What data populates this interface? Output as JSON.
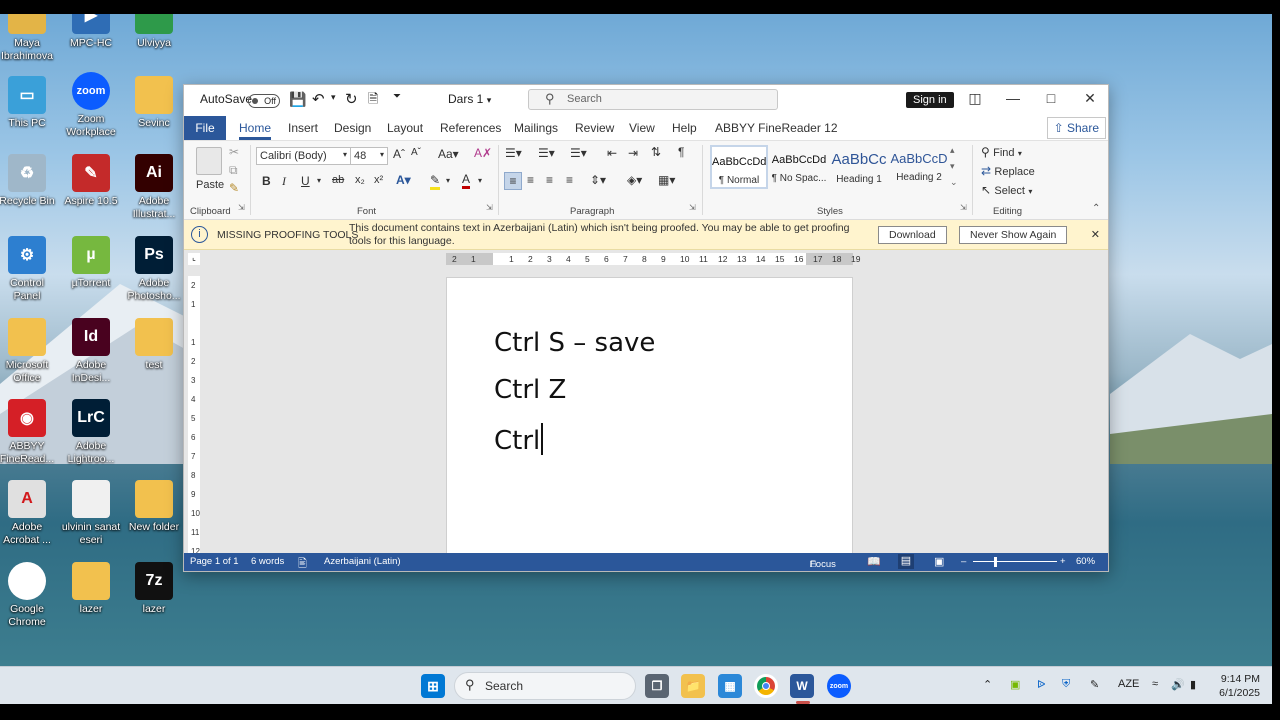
{
  "desktop": {
    "icons": [
      {
        "label": "Maya\nIbrahimova",
        "icon": "folder-user-icon"
      },
      {
        "label": "MPC-HC",
        "icon": "mpc-icon"
      },
      {
        "label": "Ulviyya",
        "icon": "chrome-profile-icon"
      },
      {
        "label": "This PC",
        "icon": "monitor-icon"
      },
      {
        "label": "Zoom\nWorkplace",
        "icon": "zoom-icon"
      },
      {
        "label": "Sevinc",
        "icon": "folder-icon"
      },
      {
        "label": "Recycle Bin",
        "icon": "recycle-bin-icon"
      },
      {
        "label": "Aspire 10.5",
        "icon": "aspire-icon"
      },
      {
        "label": "Adobe\nIllustrat...",
        "icon": "illustrator-icon"
      },
      {
        "label": "Control Panel",
        "icon": "control-panel-icon"
      },
      {
        "label": "µTorrent",
        "icon": "utorrent-icon"
      },
      {
        "label": "Adobe\nPhotosho...",
        "icon": "photoshop-icon"
      },
      {
        "label": "Microsoft\nOffice",
        "icon": "folder-icon"
      },
      {
        "label": "Adobe\nInDesi...",
        "icon": "indesign-icon"
      },
      {
        "label": "test",
        "icon": "folder-icon"
      },
      {
        "label": "ABBYY\nFineRead...",
        "icon": "abbyy-icon"
      },
      {
        "label": "Adobe\nLightroo...",
        "icon": "lightroom-icon"
      },
      {
        "label": "Adobe\nAcrobat ...",
        "icon": "acrobat-icon"
      },
      {
        "label": "ulvinin sanat\neseri",
        "icon": "image-file-icon"
      },
      {
        "label": "New folder",
        "icon": "folder-icon"
      },
      {
        "label": "Google\nChrome",
        "icon": "chrome-icon"
      },
      {
        "label": "lazer",
        "icon": "folder-icon"
      },
      {
        "label": "lazer",
        "icon": "7zip-icon"
      }
    ]
  },
  "word": {
    "titlebar": {
      "autosave_label": "AutoSave",
      "autosave_state": "Off",
      "doc_title": "Dars 1",
      "search_placeholder": "Search",
      "signin_label": "Sign in"
    },
    "tabs": [
      "File",
      "Home",
      "Insert",
      "Design",
      "Layout",
      "References",
      "Mailings",
      "Review",
      "View",
      "Help",
      "ABBYY FineReader 12"
    ],
    "active_tab": "Home",
    "share_label": "Share",
    "ribbon": {
      "paste_label": "Paste",
      "font_name": "Calibri (Body)",
      "font_size": "48",
      "groups": [
        "Clipboard",
        "Font",
        "Paragraph",
        "Styles",
        "Editing"
      ],
      "styles": [
        {
          "preview": "AaBbCcDd",
          "name": "¶ Normal"
        },
        {
          "preview": "AaBbCcDd",
          "name": "¶ No Spac..."
        },
        {
          "preview": "AaBbCc",
          "name": "Heading 1"
        },
        {
          "preview": "AaBbCcD",
          "name": "Heading 2"
        }
      ],
      "editing": {
        "find": "Find",
        "replace": "Replace",
        "select": "Select"
      }
    },
    "message_bar": {
      "title": "MISSING PROOFING TOOLS",
      "text": "This document contains text in Azerbaijani (Latin) which isn't being proofed. You may be able to get proofing tools for this language.",
      "download": "Download",
      "never_show": "Never Show Again"
    },
    "ruler_numbers": [
      "2",
      "1",
      "",
      "1",
      "2",
      "3",
      "4",
      "5",
      "6",
      "7",
      "8",
      "9",
      "10",
      "11",
      "12",
      "13",
      "14",
      "15",
      "16",
      "17",
      "18",
      "19"
    ],
    "vruler_numbers": [
      "2",
      "1",
      "",
      "1",
      "2",
      "3",
      "4",
      "5",
      "6",
      "7",
      "8",
      "9",
      "10",
      "11",
      "12"
    ],
    "document_lines": [
      "Ctrl S – save",
      "Ctrl Z",
      "Ctrl"
    ],
    "statusbar": {
      "page": "Page 1 of 1",
      "words": "6 words",
      "language": "Azerbaijani (Latin)",
      "focus": "Focus",
      "zoom": "60%"
    }
  },
  "taskbar": {
    "search_label": "Search",
    "language": "AZE",
    "time": "9:14 PM",
    "date": "6/1/2025"
  }
}
